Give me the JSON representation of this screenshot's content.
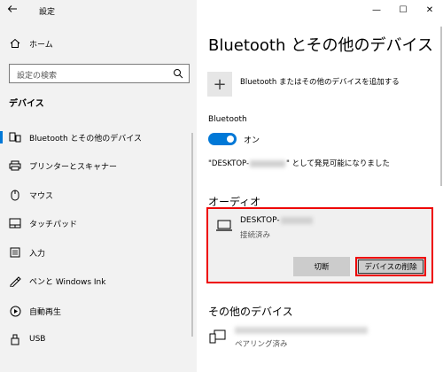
{
  "window": {
    "app_title": "設定",
    "back_icon": "arrow-left-icon",
    "minimize": "—",
    "maximize": "☐",
    "close": "✕"
  },
  "sidebar": {
    "home_label": "ホーム",
    "search_placeholder": "設定の検索",
    "section_title": "デバイス",
    "items": [
      {
        "label": "Bluetooth とその他のデバイス",
        "icon": "bluetooth-devices-icon",
        "selected": true
      },
      {
        "label": "プリンターとスキャナー",
        "icon": "printer-icon",
        "selected": false
      },
      {
        "label": "マウス",
        "icon": "mouse-icon",
        "selected": false
      },
      {
        "label": "タッチパッド",
        "icon": "touchpad-icon",
        "selected": false
      },
      {
        "label": "入力",
        "icon": "keyboard-icon",
        "selected": false
      },
      {
        "label": "ペンと Windows Ink",
        "icon": "pen-icon",
        "selected": false
      },
      {
        "label": "自動再生",
        "icon": "autoplay-icon",
        "selected": false
      },
      {
        "label": "USB",
        "icon": "usb-icon",
        "selected": false
      }
    ]
  },
  "main": {
    "title": "Bluetooth とその他のデバイス",
    "add_device_label": "Bluetooth またはその他のデバイスを追加する",
    "bluetooth_label": "Bluetooth",
    "bluetooth_state": "オン",
    "discover_prefix": "\"DESKTOP-",
    "discover_suffix": "\" として発見可能になりました",
    "audio_section": "オーディオ",
    "audio_device": {
      "name_prefix": "DESKTOP-",
      "status": "接続済み",
      "disconnect_label": "切断",
      "remove_label": "デバイスの削除"
    },
    "other_section": "その他のデバイス",
    "other_device": {
      "status": "ペアリング済み"
    }
  },
  "colors": {
    "accent": "#0078d7",
    "highlight_border": "#e00000",
    "sidebar_bg": "#f2f2f2",
    "card_bg": "#f0f0f0",
    "button_bg": "#cccccc"
  }
}
